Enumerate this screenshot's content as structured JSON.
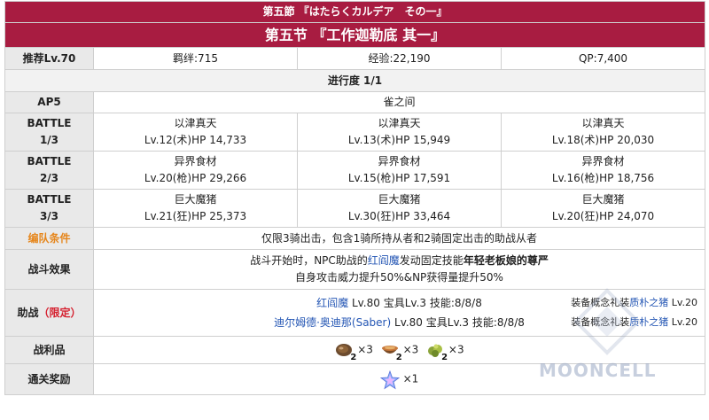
{
  "header": {
    "title_jp": "第五節 『はたらくカルデア　その一』",
    "title_cn": "第五节 『工作迦勒底 其一』"
  },
  "info": {
    "level_label": "推荐Lv.70",
    "bond": "羁绊:715",
    "exp": "经验:22,190",
    "qp": "QP:7,400"
  },
  "progress": "进行度 1/1",
  "ap": {
    "label": "AP5",
    "location": "雀之间"
  },
  "battles": [
    {
      "label_top": "BATTLE",
      "label_bottom": "1/3",
      "enemies": [
        {
          "name": "以津真天",
          "stat": "Lv.12(术)HP 14,733"
        },
        {
          "name": "以津真天",
          "stat": "Lv.13(术)HP 15,949"
        },
        {
          "name": "以津真天",
          "stat": "Lv.18(术)HP 20,030"
        }
      ]
    },
    {
      "label_top": "BATTLE",
      "label_bottom": "2/3",
      "enemies": [
        {
          "name": "异界食材",
          "stat": "Lv.20(枪)HP 29,266"
        },
        {
          "name": "异界食材",
          "stat": "Lv.15(枪)HP 17,591"
        },
        {
          "name": "异界食材",
          "stat": "Lv.16(枪)HP 18,756"
        }
      ]
    },
    {
      "label_top": "BATTLE",
      "label_bottom": "3/3",
      "enemies": [
        {
          "name": "巨大魔猪",
          "stat": "Lv.21(狂)HP 25,373"
        },
        {
          "name": "巨大魔猪",
          "stat": "Lv.30(狂)HP 33,464"
        },
        {
          "name": "巨大魔猪",
          "stat": "Lv.20(狂)HP 24,070"
        }
      ]
    }
  ],
  "formation": {
    "label": "编队条件",
    "text": "仅限3骑出击，包含1骑所持从者和2骑固定出击的助战从者"
  },
  "effect": {
    "label": "战斗效果",
    "line1_pre": "战斗开始时，NPC助战的",
    "line1_servant": "红阎魔",
    "line1_mid": "发动固定技能",
    "line1_skill": "年轻老板娘的尊严",
    "line2": "自身攻击威力提升50%&NP获得量提升50%"
  },
  "support": {
    "label_main": "助战",
    "label_paren": "（限定）",
    "rows": [
      {
        "servant": "红阎魔",
        "detail": " Lv.80 宝具Lv.3 技能:8/8/8",
        "ce_pre": "装备概念礼装",
        "ce_name": "质朴之猪",
        "ce_lv": " Lv.20"
      },
      {
        "servant": "迪尔姆德·奥迪那(Saber)",
        "detail": " Lv.80 宝具Lv.3 技能:8/8/8",
        "ce_pre": "装备概念礼装",
        "ce_name": "质朴之猪",
        "ce_lv": " Lv.20"
      }
    ]
  },
  "drops": {
    "label": "战利品",
    "items": [
      {
        "icon": "meat-icon",
        "badge": "2",
        "qty": "×3"
      },
      {
        "icon": "bowl-icon",
        "badge": "2",
        "qty": "×3"
      },
      {
        "icon": "herb-icon",
        "badge": "2",
        "qty": "×3"
      }
    ]
  },
  "clear": {
    "label": "通关奖励",
    "items": [
      {
        "icon": "saint-quartz-icon",
        "qty": "×1"
      }
    ]
  },
  "watermark": "MOONCELL",
  "colors": {
    "header_bg": "#a81c41",
    "accent_red": "#d5202f",
    "link_blue": "#2456b4",
    "orange": "#e6861c"
  }
}
